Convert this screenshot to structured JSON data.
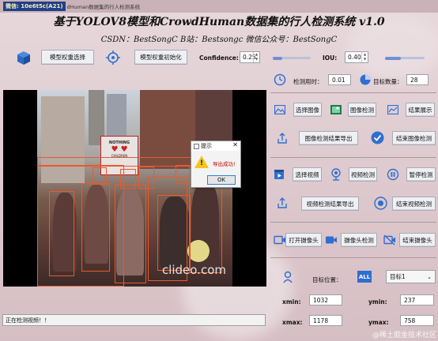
{
  "window": {
    "title_chip": "微信: 10e6t5c(A21)",
    "title_text": "dHuman数据集的行人检测系统"
  },
  "header": {
    "title": "基于YOLOV8模型和CrowdHuman数据集的行人检测系统 v1.0",
    "subtitle": "CSDN：BestSongC   B站：Bestsongc   微信公众号：BestSongC"
  },
  "toolbar": {
    "select_weights": "模型权重选择",
    "init_weights": "模型权重初始化",
    "confidence_label": "Confidence:",
    "confidence_value": "0.25",
    "confidence_slider": 0.25,
    "iou_label": "IOU:",
    "iou_value": "0.40",
    "iou_slider": 0.4
  },
  "stats": {
    "time_label": "检测用时：",
    "time_value": "0.01",
    "count_label": "目标数量：",
    "count_value": "28"
  },
  "image_controls": {
    "select_image": "选择图像",
    "image_detect": "图像检测",
    "show_results": "结果展示",
    "export_image": "图像检测结果导出",
    "end_image": "结束图像检测"
  },
  "video_controls": {
    "select_video": "选择视频",
    "video_detect": "视频检测",
    "pause_detect": "暂停检测",
    "export_video": "视频检测结果导出",
    "end_video": "结束视频检测"
  },
  "camera_controls": {
    "open_camera": "打开摄像头",
    "camera_detect": "摄像头检测",
    "close_camera": "结束摄像头"
  },
  "target": {
    "position_label": "目标位置：",
    "all_badge": "ALL",
    "selected": "目标1",
    "xmin_label": "xmin:",
    "xmin_value": "1032",
    "ymin_label": "ymin:",
    "ymin_value": "237",
    "xmax_label": "xmax:",
    "xmax_value": "1178",
    "ymax_label": "ymax:",
    "ymax_value": "758"
  },
  "dialog": {
    "title": "提示",
    "message": "导出成功!",
    "ok": "OK"
  },
  "image_overlay": {
    "watermark": "clideo.com",
    "sign_text_1": "NOTHING",
    "sign_text_2": "CHILDREN"
  },
  "status_bar": {
    "text": "正在检测视频！！"
  },
  "footer_watermark": "@稀土掘金技术社区",
  "colors": {
    "accent_blue": "#2f6fd0",
    "box_orange": "#e85a2b",
    "title_chip_bg": "#223f8a"
  }
}
